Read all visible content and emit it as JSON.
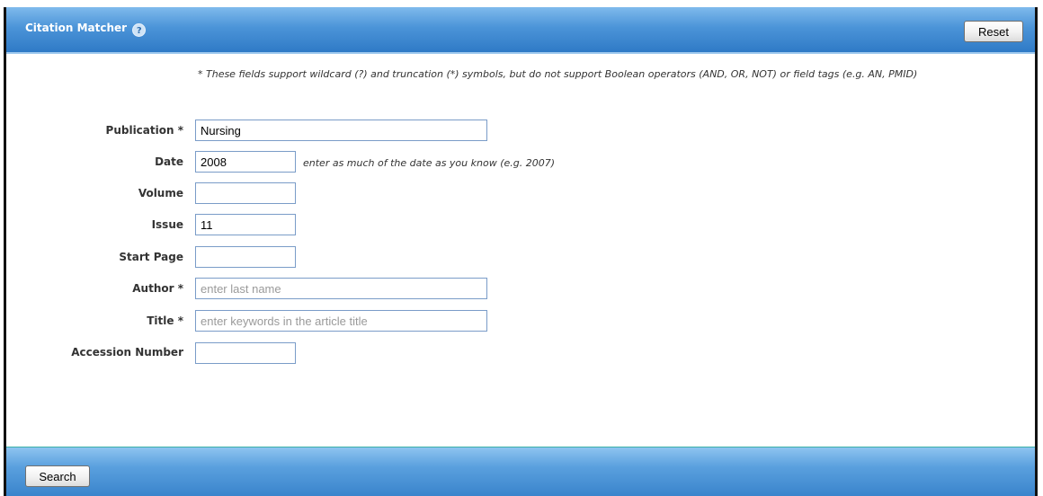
{
  "header": {
    "title": "Citation Matcher",
    "help_glyph": "?",
    "reset_label": "Reset"
  },
  "form": {
    "note": "* These fields support wildcard (?) and truncation (*) symbols, but do not support Boolean operators (AND, OR, NOT) or field tags (e.g. AN, PMID)",
    "date_hint": "enter as much of the date as you know (e.g. 2007)",
    "fields": {
      "publication": {
        "label": "Publication *",
        "value": "Nursing",
        "placeholder": ""
      },
      "date": {
        "label": "Date",
        "value": "2008",
        "placeholder": ""
      },
      "volume": {
        "label": "Volume",
        "value": "",
        "placeholder": ""
      },
      "issue": {
        "label": "Issue",
        "value": "11",
        "placeholder": ""
      },
      "start_page": {
        "label": "Start Page",
        "value": "",
        "placeholder": ""
      },
      "author": {
        "label": "Author *",
        "value": "",
        "placeholder": "enter last name"
      },
      "title": {
        "label": "Title *",
        "value": "",
        "placeholder": "enter keywords in the article title"
      },
      "accession_number": {
        "label": "Accession Number",
        "value": "",
        "placeholder": ""
      }
    }
  },
  "footer": {
    "search_label": "Search"
  },
  "colors": {
    "header_blue": "#4b94d8",
    "footer_blue": "#5aa0de",
    "field_border": "#7a9cc8"
  }
}
